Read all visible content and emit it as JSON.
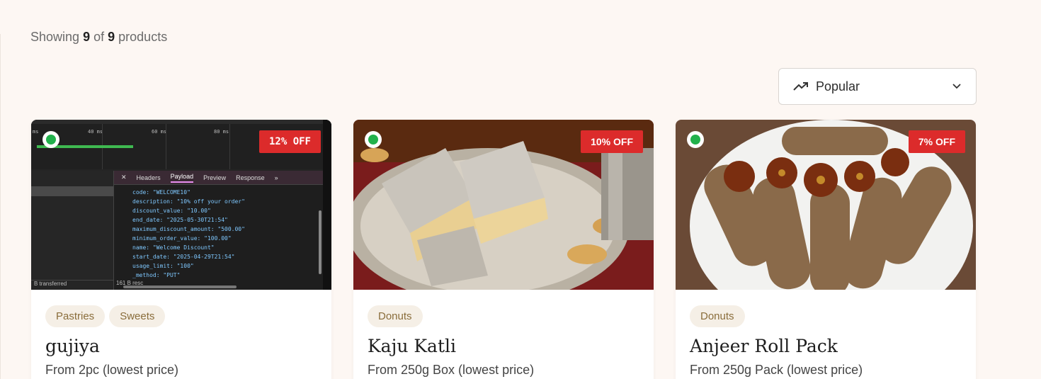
{
  "listing": {
    "showing_prefix": "Showing",
    "shown_count": "9",
    "of_word": "of",
    "total_count": "9",
    "suffix": "products"
  },
  "sort": {
    "icon": "trending-up-icon",
    "selected": "Popular",
    "chevron": "chevron-down-icon"
  },
  "accent_colors": {
    "discount_badge": "#dc2b2b",
    "availability_dot": "#22b14c",
    "tag_bg": "#f5efe6",
    "tag_text": "#8a6d3b"
  },
  "products": [
    {
      "badge": "12% OFF",
      "tags": [
        "Pastries",
        "Sweets"
      ],
      "name": "gujiya",
      "price_text": "From 2pc (lowest price)",
      "image": {
        "type": "devtools-screenshot",
        "timeline_labels": [
          "ms",
          "40 ms",
          "60 ms",
          "80 ms"
        ],
        "tabs": [
          "Headers",
          "Payload",
          "Preview",
          "Response"
        ],
        "active_tab": "Payload",
        "payload_lines": [
          "code: \"WELCOME10\"",
          "description: \"10% off your order\"",
          "discount_value: \"10.00\"",
          "end_date: \"2025-05-30T21:54\"",
          "maximum_discount_amount: \"500.00\"",
          "minimum_order_value: \"100.00\"",
          "name: \"Welcome Discount\"",
          "start_date: \"2025-04-29T21:54\"",
          "usage_limit: \"100\"",
          "_method: \"PUT\""
        ],
        "status_left": "B transferred",
        "status_right": "161 B resc"
      }
    },
    {
      "badge": "10% OFF",
      "tags": [
        "Donuts"
      ],
      "name": "Kaju Katli",
      "price_text": "From 250g Box (lowest price)"
    },
    {
      "badge": "7% OFF",
      "tags": [
        "Donuts"
      ],
      "name": "Anjeer Roll Pack",
      "price_text": "From 250g Pack (lowest price)"
    }
  ]
}
